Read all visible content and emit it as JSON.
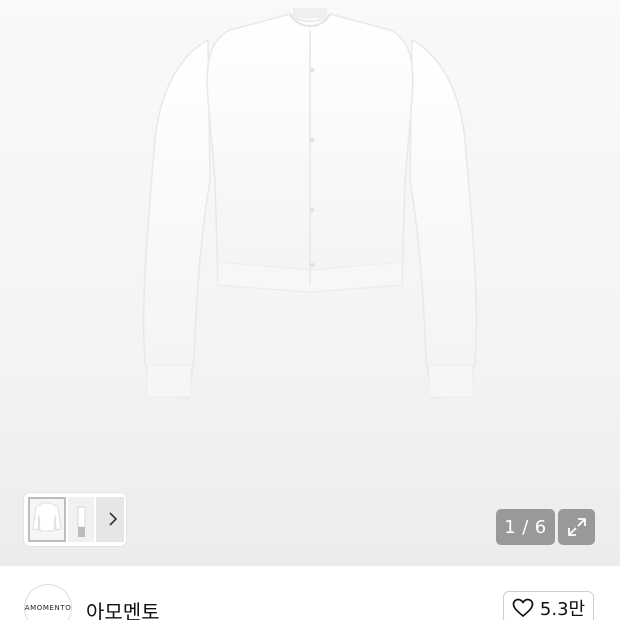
{
  "gallery": {
    "current": "1",
    "separator": "/",
    "total": "6",
    "thumbnail_count": 3
  },
  "seller": {
    "logo_text": "AMOMENTO",
    "name": "아모멘토"
  },
  "like": {
    "count": "5.3만"
  },
  "icons": {
    "thumb_next": "chevron-right-icon",
    "expand": "expand-arrows-icon",
    "like": "heart-outline-icon"
  }
}
